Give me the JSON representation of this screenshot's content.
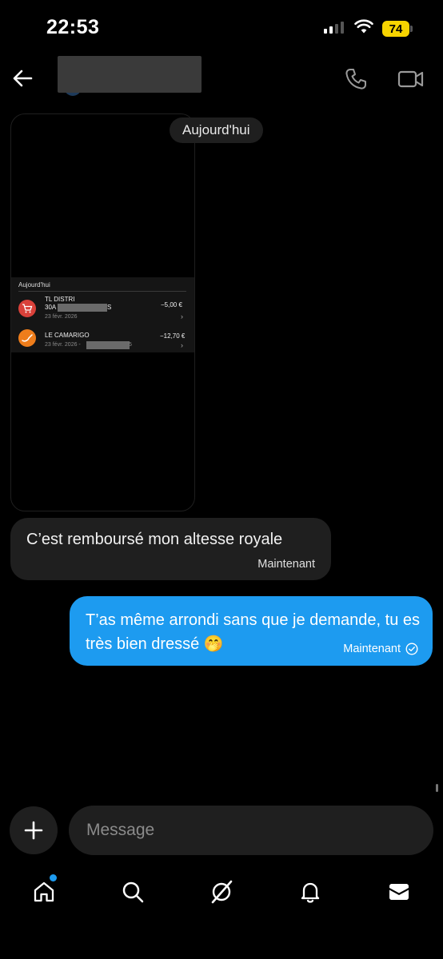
{
  "status_bar": {
    "time": "22:53",
    "battery": "74"
  },
  "header": {
    "contact_name_redacted": true
  },
  "conversation": {
    "date_label": "Aujourd'hui",
    "image_message": {
      "section_label": "Aujourd'hui",
      "transactions": [
        {
          "name": "TL DISTRI",
          "detail": "30A",
          "detail_suffix": "S",
          "date": "23 févr. 2026",
          "amount": "−5,00 €",
          "icon": "cart-icon",
          "icon_color": "#d9413a"
        },
        {
          "name": "LE CAMARIGO",
          "date": "23 févr. 2026 -",
          "date_suffix": "5",
          "amount": "−12,70 €",
          "icon": "pipe-icon",
          "icon_color": "#ee7d1b"
        }
      ]
    },
    "messages": [
      {
        "direction": "received",
        "text": "C’est remboursé mon altesse royale",
        "time": "Maintenant"
      },
      {
        "direction": "sent",
        "text": "T’as même arrondi sans que je demande, tu es très bien dressé 🤭",
        "time": "Maintenant",
        "status": "read-check-icon"
      }
    ]
  },
  "composer": {
    "placeholder": "Message"
  },
  "tab_bar": {
    "items": [
      "home-icon",
      "search-icon",
      "grok-icon",
      "notifications-icon",
      "messages-icon"
    ],
    "active": "messages-icon",
    "accent": "#1d9bf0"
  }
}
